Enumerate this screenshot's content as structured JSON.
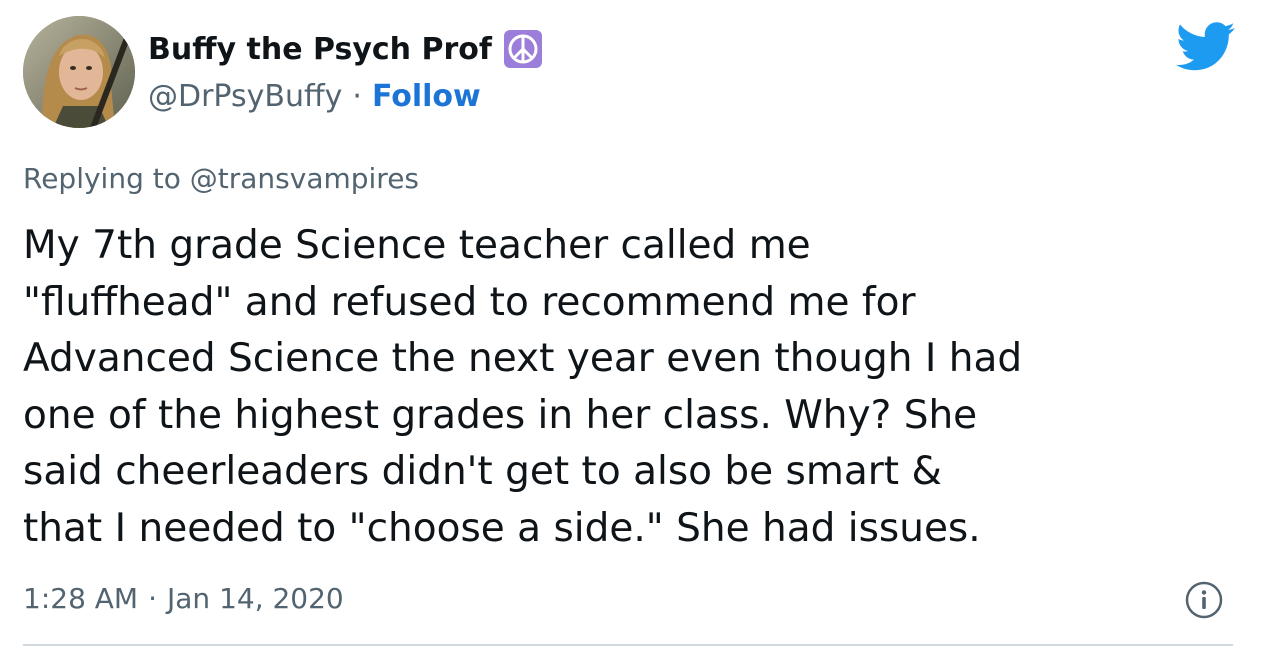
{
  "author": {
    "display_name": "Buffy the Psych Prof",
    "name_emoji": "peace-symbol-emoji",
    "handle": "@DrPsyBuffy",
    "separator": "·",
    "follow_label": "Follow",
    "avatar": "avatar-photo"
  },
  "platform_icon": "twitter-bird-icon",
  "reply": {
    "prefix": "Replying to",
    "mention": "@transvampires"
  },
  "tweet": {
    "lines": [
      "My 7th grade Science teacher called me",
      "\"fluffhead\" and refused to recommend me for",
      "Advanced Science the next year even though I had",
      "one of the highest grades in her class. Why? She",
      "said cheerleaders didn't get to also be smart &",
      "that I needed to \"choose a side.\" She had issues."
    ]
  },
  "meta": {
    "time": "1:28 AM",
    "separator": "·",
    "date": "Jan 14, 2020",
    "info_icon": "info-icon"
  },
  "colors": {
    "text": "#0f1419",
    "secondary": "#536471",
    "link": "#1b74d6",
    "twitter_blue": "#1d9bf0",
    "divider": "#cfd9de",
    "emoji_purple": "#9b7ed9"
  }
}
